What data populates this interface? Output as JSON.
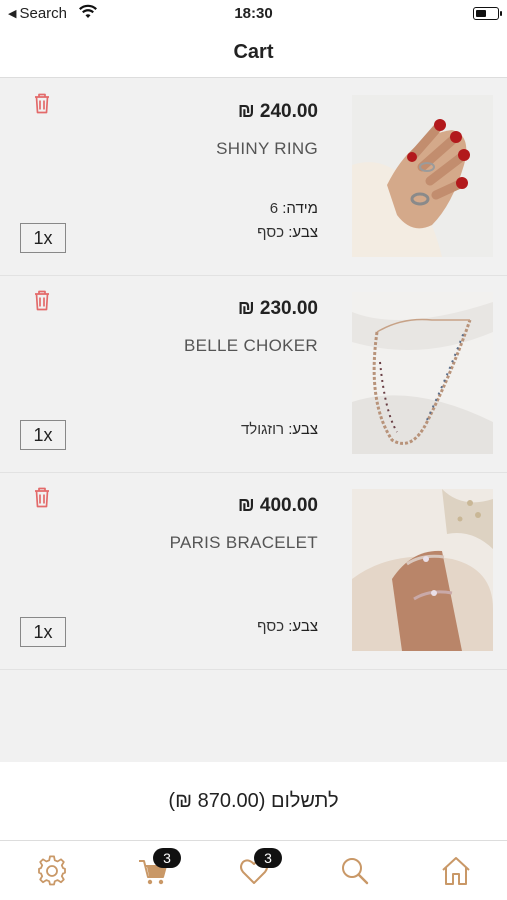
{
  "status_bar": {
    "back_label": "Search",
    "time": "18:30"
  },
  "header": {
    "title": "Cart"
  },
  "cart": {
    "items": [
      {
        "price": "₪ 240.00",
        "name": "SHINY RING",
        "attributes": [
          {
            "label": "מידה:",
            "value": "6"
          },
          {
            "label": "צבע:",
            "value": "כסף"
          }
        ],
        "quantity": "1x",
        "image": "ring-photo"
      },
      {
        "price": "₪ 230.00",
        "name": "BELLE CHOKER",
        "attributes": [
          {
            "label": "צבע:",
            "value": "רוזגולד"
          }
        ],
        "quantity": "1x",
        "image": "choker-photo"
      },
      {
        "price": "₪ 400.00",
        "name": "PARIS BRACELET",
        "attributes": [
          {
            "label": "צבע:",
            "value": "כסף"
          }
        ],
        "quantity": "1x",
        "image": "bracelet-photo"
      }
    ]
  },
  "checkout": {
    "pay_label": "לתשלום (870.00 ₪)"
  },
  "tab_bar": {
    "tabs": [
      {
        "icon": "gear-icon"
      },
      {
        "icon": "cart-icon",
        "badge": "3"
      },
      {
        "icon": "heart-icon",
        "badge": "3"
      },
      {
        "icon": "search-icon"
      },
      {
        "icon": "home-icon"
      }
    ]
  },
  "colors": {
    "accent": "#c99867",
    "delete": "#e36a6a"
  }
}
